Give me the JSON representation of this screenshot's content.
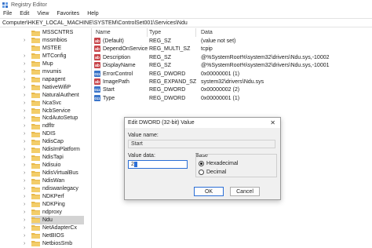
{
  "window": {
    "title": "Registry Editor"
  },
  "menu": [
    "File",
    "Edit",
    "View",
    "Favorites",
    "Help"
  ],
  "address": "Computer\\HKEY_LOCAL_MACHINE\\SYSTEM\\ControlSet001\\Services\\Ndu",
  "tree": {
    "items": [
      {
        "label": "MSSCNTRS",
        "expandable": false
      },
      {
        "label": "mssmbios",
        "expandable": true
      },
      {
        "label": "MSTEE",
        "expandable": false
      },
      {
        "label": "MTConfig",
        "expandable": true
      },
      {
        "label": "Mup",
        "expandable": true
      },
      {
        "label": "mvumis",
        "expandable": true
      },
      {
        "label": "napagent",
        "expandable": true
      },
      {
        "label": "NativeWifiP",
        "expandable": true
      },
      {
        "label": "NaturalAuthent",
        "expandable": true
      },
      {
        "label": "NcaSvc",
        "expandable": true
      },
      {
        "label": "NcbService",
        "expandable": true
      },
      {
        "label": "NcdAutoSetup",
        "expandable": true
      },
      {
        "label": "ndfltr",
        "expandable": true
      },
      {
        "label": "NDIS",
        "expandable": true
      },
      {
        "label": "NdisCap",
        "expandable": true
      },
      {
        "label": "NdisImPlatform",
        "expandable": true
      },
      {
        "label": "NdisTapi",
        "expandable": true
      },
      {
        "label": "Ndisuio",
        "expandable": true
      },
      {
        "label": "NdisVirtualBus",
        "expandable": true
      },
      {
        "label": "NdisWan",
        "expandable": true
      },
      {
        "label": "ndiswanlegacy",
        "expandable": true
      },
      {
        "label": "NDKPerf",
        "expandable": true
      },
      {
        "label": "NDKPing",
        "expandable": true
      },
      {
        "label": "ndproxy",
        "expandable": true
      },
      {
        "label": "Ndu",
        "expandable": true,
        "selected": true
      },
      {
        "label": "NetAdapterCx",
        "expandable": true
      },
      {
        "label": "NetBIOS",
        "expandable": true
      },
      {
        "label": "NetbiosSmb",
        "expandable": true
      }
    ]
  },
  "columns": {
    "name": "Name",
    "type": "Type",
    "data": "Data"
  },
  "values": [
    {
      "icon": "ab",
      "name": "(Default)",
      "type": "REG_SZ",
      "data": "(value not set)"
    },
    {
      "icon": "ab",
      "name": "DependOnService",
      "type": "REG_MULTI_SZ",
      "data": "tcpip"
    },
    {
      "icon": "ab",
      "name": "Description",
      "type": "REG_SZ",
      "data": "@%SystemRoot%\\system32\\drivers\\Ndu.sys,-10002"
    },
    {
      "icon": "ab",
      "name": "DisplayName",
      "type": "REG_SZ",
      "data": "@%SystemRoot%\\system32\\drivers\\Ndu.sys,-10001"
    },
    {
      "icon": "bin",
      "name": "ErrorControl",
      "type": "REG_DWORD",
      "data": "0x00000001 (1)"
    },
    {
      "icon": "ab",
      "name": "ImagePath",
      "type": "REG_EXPAND_SZ",
      "data": "system32\\drivers\\Ndu.sys"
    },
    {
      "icon": "bin",
      "name": "Start",
      "type": "REG_DWORD",
      "data": "0x00000002 (2)"
    },
    {
      "icon": "bin",
      "name": "Type",
      "type": "REG_DWORD",
      "data": "0x00000001 (1)"
    }
  ],
  "dialog": {
    "title": "Edit DWORD (32-bit) Value",
    "close_glyph": "✕",
    "value_name_label": "Value name:",
    "value_name": "Start",
    "value_data_label": "Value data:",
    "value_data": "2",
    "base_label": "Base",
    "base_options": [
      "Hexadecimal",
      "Decimal"
    ],
    "base_selected": 0,
    "ok_label": "OK",
    "cancel_label": "Cancel"
  },
  "colors": {
    "accent": "#2c6fd6",
    "string_icon": "#c8454a",
    "binary_icon": "#3a74c9",
    "folder": "#e8b84a"
  }
}
